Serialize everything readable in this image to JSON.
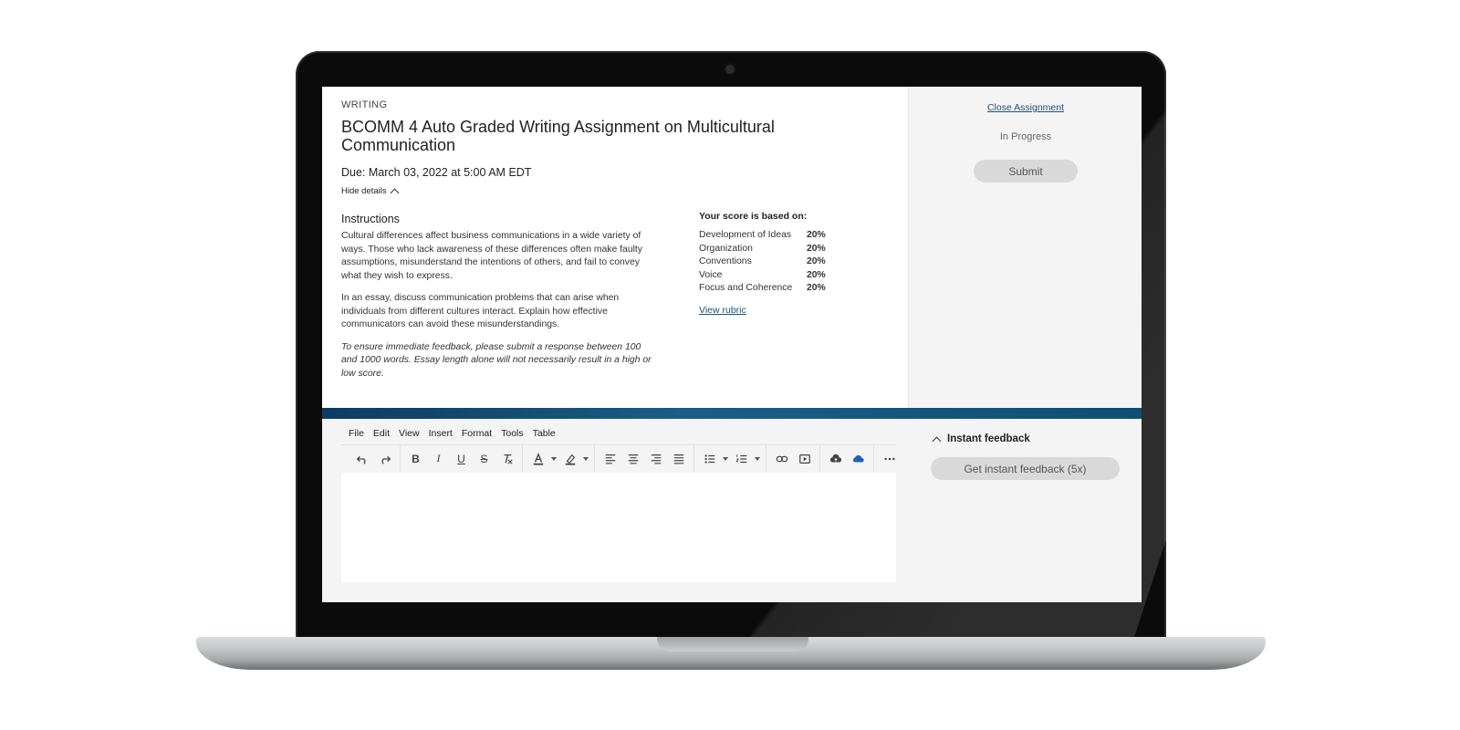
{
  "assignment": {
    "category": "WRITING",
    "title": "BCOMM 4 Auto Graded Writing Assignment on Multicultural Communication",
    "due": "Due: March 03, 2022 at 5:00 AM EDT",
    "hide_details_label": "Hide details"
  },
  "instructions": {
    "heading": "Instructions",
    "paragraphs": [
      "Cultural differences affect business communications in a wide variety of ways. Those who lack awareness of these differences often make faulty assumptions, misunderstand the intentions of others, and fail to convey what they wish to express.",
      "In an essay, discuss communication problems that can arise when individuals from different cultures interact. Explain how effective communicators can avoid these misunderstandings."
    ],
    "note": "To ensure immediate feedback, please submit a response between 100 and 1000 words. Essay length alone will not necessarily result in a high or low score."
  },
  "score": {
    "heading": "Your score is based on:",
    "criteria": [
      {
        "name": "Development of Ideas",
        "weight": "20%"
      },
      {
        "name": "Organization",
        "weight": "20%"
      },
      {
        "name": "Conventions",
        "weight": "20%"
      },
      {
        "name": "Voice",
        "weight": "20%"
      },
      {
        "name": "Focus and Coherence",
        "weight": "20%"
      }
    ],
    "rubric_link": "View rubric"
  },
  "side_panel": {
    "close_link": "Close Assignment",
    "status": "In Progress",
    "submit_label": "Submit"
  },
  "editor": {
    "menu": [
      "File",
      "Edit",
      "View",
      "Insert",
      "Format",
      "Tools",
      "Table"
    ],
    "toolbar_icons": [
      "undo-icon",
      "redo-icon",
      "bold-icon",
      "italic-icon",
      "underline-icon",
      "strikethrough-icon",
      "clear-format-icon",
      "text-color-icon",
      "highlight-color-icon",
      "align-left-icon",
      "align-center-icon",
      "align-right-icon",
      "align-justify-icon",
      "bullet-list-icon",
      "numbered-list-icon",
      "link-icon",
      "media-icon",
      "cloud-upload-icon",
      "onedrive-icon",
      "more-icon"
    ],
    "accent_color": "#0d4f75",
    "onedrive_color": "#1f5fbf"
  },
  "feedback": {
    "heading": "Instant feedback",
    "button_label": "Get instant feedback (5x)"
  }
}
